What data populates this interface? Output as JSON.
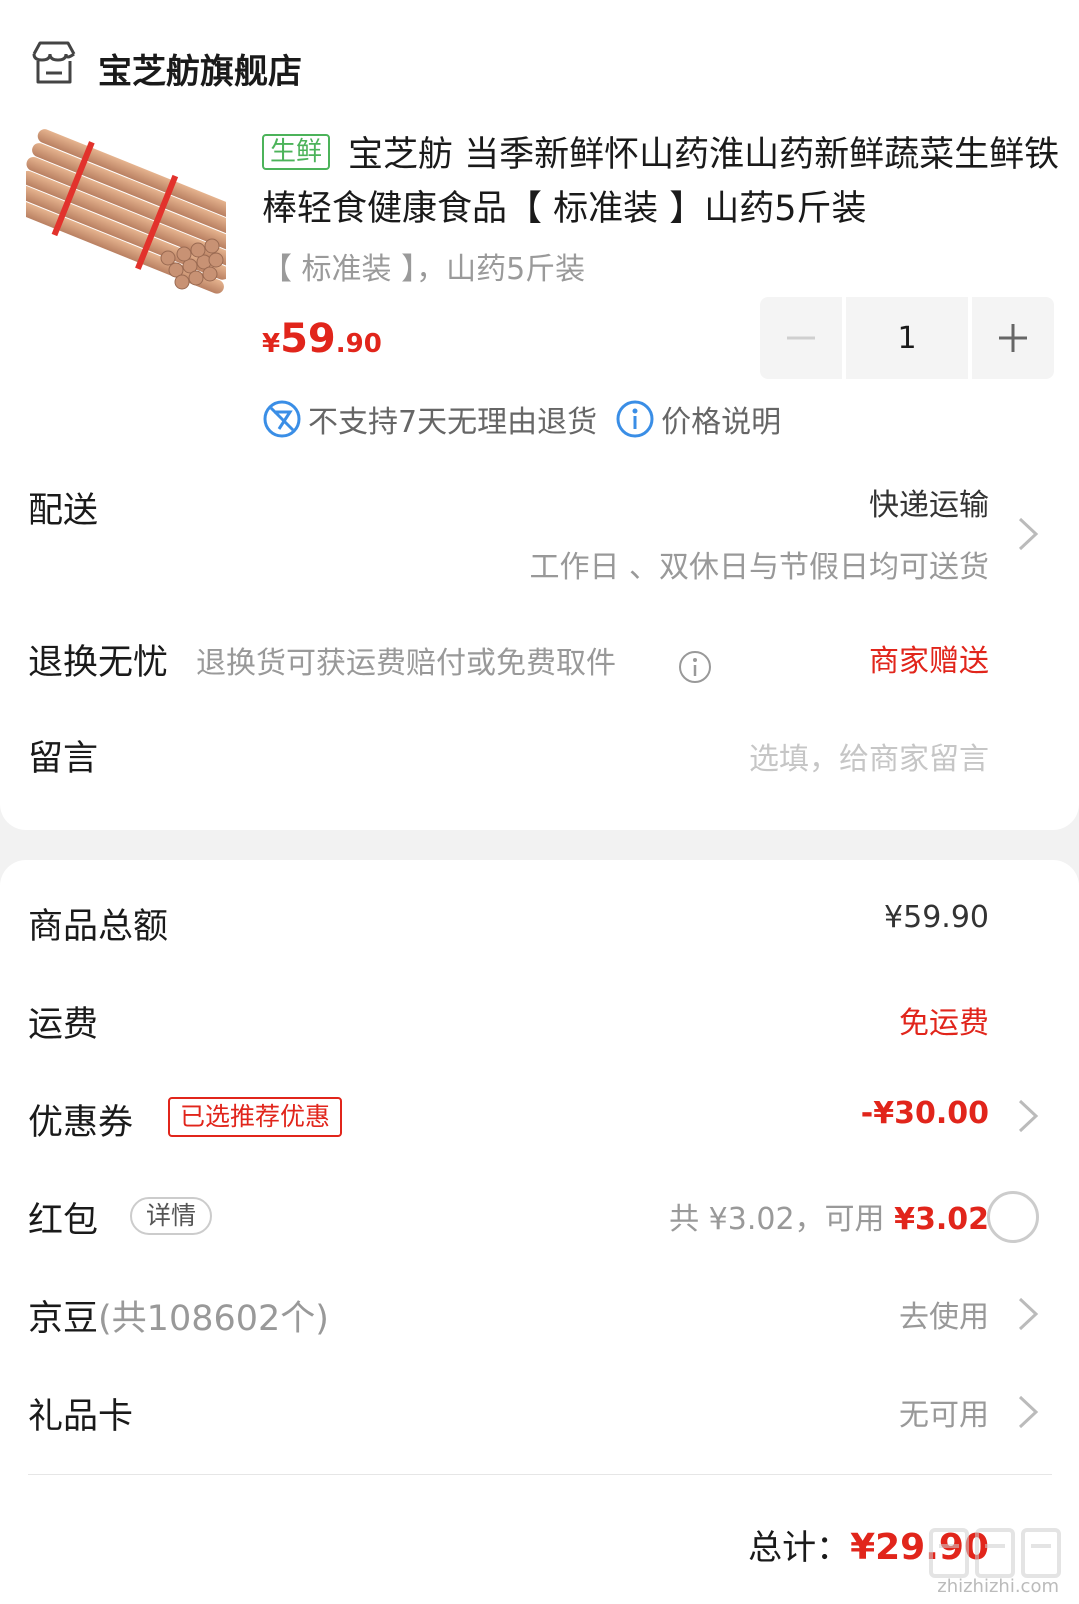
{
  "store": {
    "name": "宝芝舫旗舰店",
    "icon": "store-icon"
  },
  "product": {
    "tag": "生鲜",
    "title": "宝芝舫 当季新鲜怀山药淮山药新鲜蔬菜生鲜铁棒轻食健康食品【 标准装 】山药5斤装",
    "spec": "【 标准装 】，山药5斤装",
    "price_currency": "¥",
    "price_int": "59",
    "price_dec": ".90",
    "quantity": "1",
    "policy_text": "不支持7天无理由退货",
    "price_note": "价格说明"
  },
  "delivery": {
    "label": "配送",
    "method": "快递运输",
    "note": "工作日 、双休日与节假日均可送货"
  },
  "returns": {
    "label": "退换无忧",
    "desc": "退换货可获运费赔付或免费取件",
    "value": "商家赠送"
  },
  "message": {
    "label": "留言",
    "placeholder": "选填，给商家留言"
  },
  "summary": {
    "goods_label": "商品总额",
    "goods_value": "¥59.90",
    "shipping_label": "运费",
    "shipping_value": "免运费",
    "coupon_label": "优惠券",
    "coupon_tag": "已选推荐优惠",
    "coupon_value": "-¥30.00",
    "redpacket_label": "红包",
    "redpacket_detail": "详情",
    "redpacket_total": "共 ¥3.02，可用 ",
    "redpacket_avail": "¥3.02",
    "jd_label": "京豆",
    "jd_count": "(共108602个)",
    "jd_value": "去使用",
    "gift_label": "礼品卡",
    "gift_value": "无可用"
  },
  "total": {
    "label": "总计：",
    "value": "¥29.90"
  },
  "watermark": {
    "text": "zhizhizhi.com"
  },
  "colors": {
    "accent": "#e1251b",
    "fresh": "#4cb35a",
    "info": "#3a8ee6"
  }
}
